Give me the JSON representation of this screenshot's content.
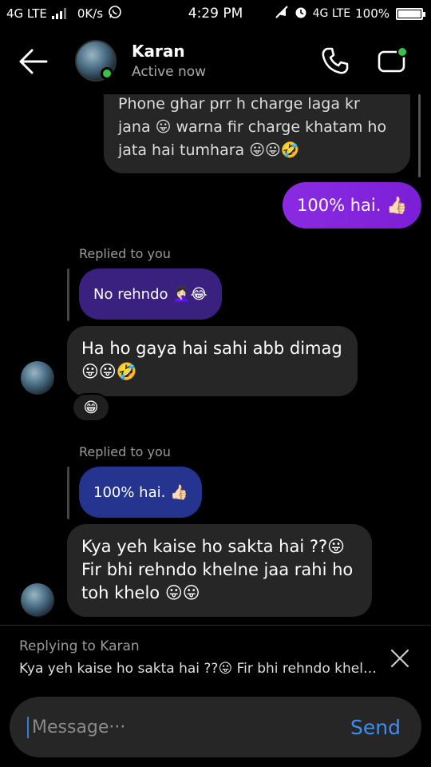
{
  "status_bar": {
    "network_left": "4G LTE",
    "speed": "0K/s",
    "time": "4:29 PM",
    "network_right": "4G LTE",
    "battery": "100%"
  },
  "header": {
    "contact_name": "Karan",
    "contact_status": "Active now",
    "online": true
  },
  "messages": [
    {
      "id": "m1",
      "direction": "incoming",
      "text": "Phone ghar prr h charge laga kr jana 😛 warna fir charge khatam ho jata hai tumhara 😛😛🤣"
    },
    {
      "id": "m2",
      "direction": "outgoing",
      "text": "100% hai. 👍🏻"
    },
    {
      "id": "m3",
      "direction": "incoming",
      "reply_label": "Replied to you",
      "quoted_text": "No rehndo 🤦🏻‍♀️😂",
      "text": "Ha ho gaya hai sahi abb dimag 😛😛🤣",
      "reaction": "😁"
    },
    {
      "id": "m4",
      "direction": "incoming",
      "reply_label": "Replied to you",
      "quoted_text": "100% hai. 👍🏻",
      "text": "Kya yeh kaise ho sakta hai ??😛 Fir bhi rehndo khelne jaa rahi ho toh khelo 😛😛"
    }
  ],
  "reply_bar": {
    "title": "Replying to Karan",
    "preview": "Kya yeh kaise ho sakta hai ??😛 Fir bhi rehndo kheln…"
  },
  "composer": {
    "placeholder": "Message···",
    "send_label": "Send"
  },
  "colors": {
    "outgoing_bubble": "#7b1fd6",
    "incoming_bubble": "#262626",
    "quoted_purple": "#3a2180",
    "quoted_blue": "#25348f",
    "send_accent": "#3b8ff2",
    "online": "#3cc04a"
  }
}
